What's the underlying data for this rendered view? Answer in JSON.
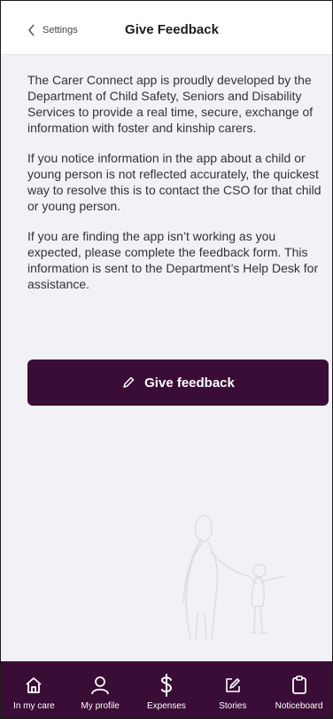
{
  "header": {
    "back_label": "Settings",
    "title": "Give Feedback"
  },
  "content": {
    "paragraphs": [
      "The Carer Connect app is proudly developed by the Department of Child Safety, Seniors and Disability Services to provide a real time, secure, exchange of information with foster and kinship carers.",
      "If you notice information in the app about a child or young person is not reflected accurately, the quickest way to resolve this is to contact the CSO for that child or young person.",
      "If you are finding the app isn’t working as you expected, please complete the feedback form. This information is sent to the Department’s Help Desk for assistance."
    ],
    "cta_label": "Give feedback"
  },
  "tabbar": {
    "items": [
      {
        "label": "In my care",
        "icon": "home-icon"
      },
      {
        "label": "My profile",
        "icon": "person-icon"
      },
      {
        "label": "Expenses",
        "icon": "dollar-icon"
      },
      {
        "label": "Stories",
        "icon": "edit-icon"
      },
      {
        "label": "Noticeboard",
        "icon": "clipboard-icon"
      }
    ]
  },
  "colors": {
    "brand": "#3a0d36",
    "background": "#f2f2f6"
  }
}
